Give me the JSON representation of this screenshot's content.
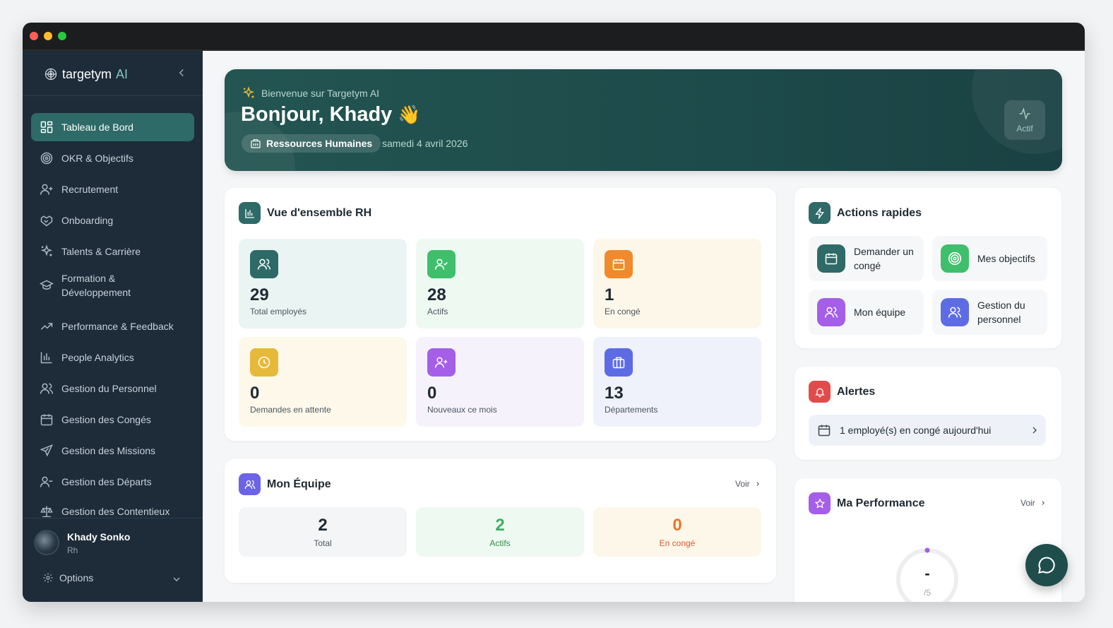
{
  "app": {
    "brand_name": "targetym",
    "brand_suffix": "AI"
  },
  "sidebar": {
    "items": [
      {
        "label": "Tableau de Bord",
        "icon": "dashboard-icon",
        "active": true
      },
      {
        "label": "OKR & Objectifs",
        "icon": "target-icon"
      },
      {
        "label": "Recrutement",
        "icon": "user-plus-icon"
      },
      {
        "label": "Onboarding",
        "icon": "handshake-icon"
      },
      {
        "label": "Talents & Carrière",
        "icon": "sparkles-icon"
      },
      {
        "label": "Formation & Développement",
        "icon": "graduation-cap-icon"
      },
      {
        "label": "Performance & Feedback",
        "icon": "trending-up-icon"
      },
      {
        "label": "People Analytics",
        "icon": "bar-chart-icon"
      },
      {
        "label": "Gestion du Personnel",
        "icon": "users-icon"
      },
      {
        "label": "Gestion des Congés",
        "icon": "calendar-icon"
      },
      {
        "label": "Gestion des Missions",
        "icon": "plane-icon"
      },
      {
        "label": "Gestion des Départs",
        "icon": "user-minus-icon"
      },
      {
        "label": "Gestion des Contentieux",
        "icon": "scale-icon"
      }
    ],
    "user": {
      "name": "Khady Sonko",
      "role": "Rh"
    },
    "options_label": "Options"
  },
  "hero": {
    "subtitle": "Bienvenue sur Targetym AI",
    "greeting": "Bonjour, Khady",
    "emoji": "👋",
    "department": "Ressources Humaines",
    "date": "samedi 4 avril 2026",
    "status": "Actif"
  },
  "overview": {
    "title": "Vue d'ensemble RH",
    "stats": [
      {
        "value": "29",
        "label": "Total employés",
        "icon": "users-icon",
        "color": "#2e6a67",
        "bg": "#eaf4f3"
      },
      {
        "value": "28",
        "label": "Actifs",
        "icon": "user-check-icon",
        "color": "#3fbf6b",
        "bg": "#eef9f2"
      },
      {
        "value": "1",
        "label": "En congé",
        "icon": "calendar-icon",
        "color": "#f08a2c",
        "bg": "#fdf7ea"
      },
      {
        "value": "0",
        "label": "Demandes en attente",
        "icon": "clock-icon",
        "color": "#e7b93b",
        "bg": "#fdf8ea"
      },
      {
        "value": "0",
        "label": "Nouveaux ce mois",
        "icon": "user-plus-icon",
        "color": "#a45ee8",
        "bg": "#f6f2fb"
      },
      {
        "value": "13",
        "label": "Départements",
        "icon": "briefcase-icon",
        "color": "#5d6ce5",
        "bg": "#eff1fb"
      }
    ]
  },
  "team": {
    "title": "Mon Équipe",
    "voir": "Voir",
    "stats": [
      {
        "value": "2",
        "label": "Total",
        "color": "#1f2a33",
        "label_color": "#4b5660",
        "bg": "#f4f5f6"
      },
      {
        "value": "2",
        "label": "Actifs",
        "color": "#3fae5f",
        "label_color": "#2f8c4b",
        "bg": "#eef9f1"
      },
      {
        "value": "0",
        "label": "En congé",
        "color": "#e8772b",
        "label_color": "#e2592b",
        "bg": "#fdf7ea"
      }
    ]
  },
  "quick_actions": {
    "title": "Actions rapides",
    "items": [
      {
        "label": "Demander un congé",
        "icon": "calendar-icon",
        "color": "#2e6a67"
      },
      {
        "label": "Mes objectifs",
        "icon": "target-icon",
        "color": "#3fbf6b"
      },
      {
        "label": "Mon équipe",
        "icon": "users-icon",
        "color": "#a45ee8"
      },
      {
        "label": "Gestion du personnel",
        "icon": "users-icon",
        "color": "#5d6ce5"
      }
    ]
  },
  "alerts": {
    "title": "Alertes",
    "items": [
      {
        "text": "1 employé(s) en congé aujourd'hui",
        "icon": "calendar-icon"
      }
    ]
  },
  "performance": {
    "title": "Ma Performance",
    "voir": "Voir",
    "score": "-",
    "max": "/5"
  },
  "colors": {
    "primary": "#2e6a67",
    "sidebar_bg": "#1e2c3a",
    "hero_bg": "#1d4a4a",
    "alert_red": "#e24b4b",
    "performance_purple": "#a45ee8"
  }
}
